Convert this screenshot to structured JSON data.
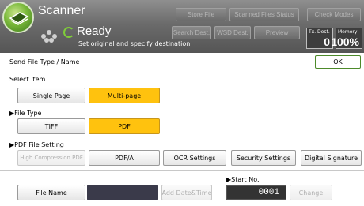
{
  "header": {
    "title": "Scanner",
    "buttons": [
      "Store File",
      "Scanned Files Status",
      "Check Modes"
    ],
    "buttons2": [
      "Search Dest.",
      "WSD Dest.",
      "Preview"
    ],
    "status": "Ready",
    "status_sub": "Set original and specify destination.",
    "tx_dest_label": "Tx. Dest.",
    "tx_dest_value": "0",
    "memory_label": "Memory",
    "memory_value": "100%"
  },
  "panel": {
    "title": "Send File Type / Name",
    "ok": "OK"
  },
  "select_item": {
    "label": "Select item.",
    "options": [
      "Single Page",
      "Multi-page"
    ],
    "selected": "Multi-page"
  },
  "file_type": {
    "label": "▶File Type",
    "options": [
      "TIFF",
      "PDF"
    ],
    "selected": "PDF"
  },
  "pdf_setting": {
    "label": "▶PDF File Setting",
    "buttons": [
      "High Compression PDF",
      "PDF/A",
      "OCR Settings",
      "Security Settings",
      "Digital Signature"
    ]
  },
  "file_name": {
    "button": "File Name",
    "add_date_time": "Add Date&Time",
    "start_no_label": "▶Start No.",
    "start_no_value": "0001",
    "change": "Change"
  },
  "colors": {
    "selected": "#ffc20e",
    "header": "#6b6b6b",
    "ready_ring": "#7fcc3a"
  }
}
